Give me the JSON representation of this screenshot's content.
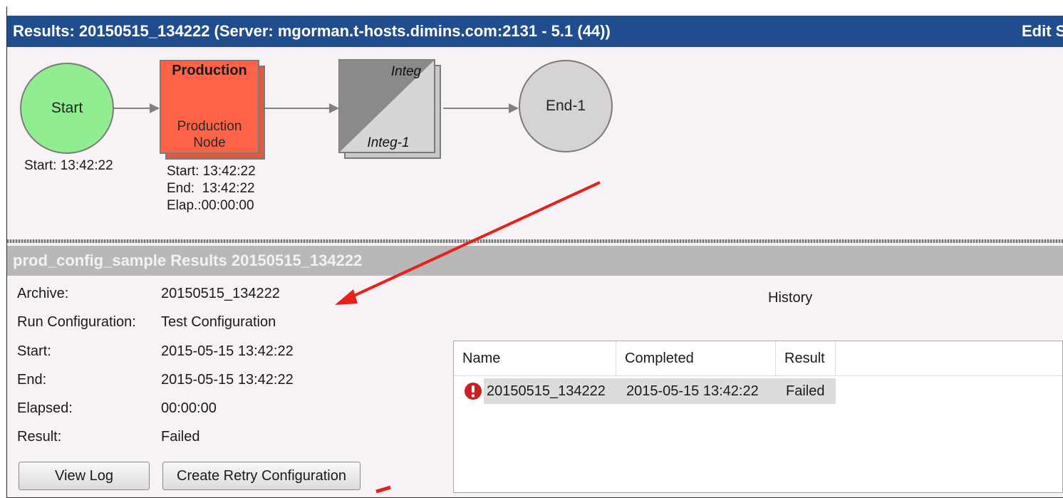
{
  "title_bar": {
    "title": "Results: 20150515_134222 (Server: mgorman.t-hosts.dimins.com:2131 - 5.1 (44))",
    "edit_label": "Edit S"
  },
  "workflow": {
    "start": {
      "label": "Start",
      "time": "Start: 13:42:22"
    },
    "production": {
      "title": "Production",
      "subtitle_line1": "Production",
      "subtitle_line2": "Node",
      "start": "Start: 13:42:22",
      "end": "End:  13:42:22",
      "elapsed": "Elap.:00:00:00"
    },
    "integ": {
      "top_label": "Integ",
      "bottom_label": "Integ-1"
    },
    "end": {
      "label": "End-1"
    }
  },
  "section": {
    "header": "prod_config_sample Results 20150515_134222"
  },
  "details": {
    "archive": {
      "label": "Archive:",
      "value": "20150515_134222"
    },
    "run_config": {
      "label": "Run Configuration:",
      "value": "Test Configuration"
    },
    "start": {
      "label": "Start:",
      "value": "2015-05-15 13:42:22"
    },
    "end": {
      "label": "End:",
      "value": "2015-05-15 13:42:22"
    },
    "elapsed": {
      "label": "Elapsed:",
      "value": "00:00:00"
    },
    "result": {
      "label": "Result:",
      "value": "Failed"
    }
  },
  "buttons": {
    "view_log": "View Log",
    "create_retry": "Create Retry Configuration"
  },
  "history": {
    "title": "History",
    "columns": [
      "Name",
      "Completed",
      "Result"
    ],
    "rows": [
      {
        "name": "20150515_134222",
        "completed": "2015-05-15 13:42:22",
        "result": "Failed",
        "status_icon": "error-icon"
      }
    ]
  },
  "colors": {
    "title_bar": "#1f4d8e",
    "start_node": "#90ee90",
    "production_node": "#ff6347",
    "integ_node": "#a9a9a9",
    "end_node": "#d6d3d6",
    "annotation_arrow": "#e8201a",
    "error": "#cc1f1f"
  }
}
